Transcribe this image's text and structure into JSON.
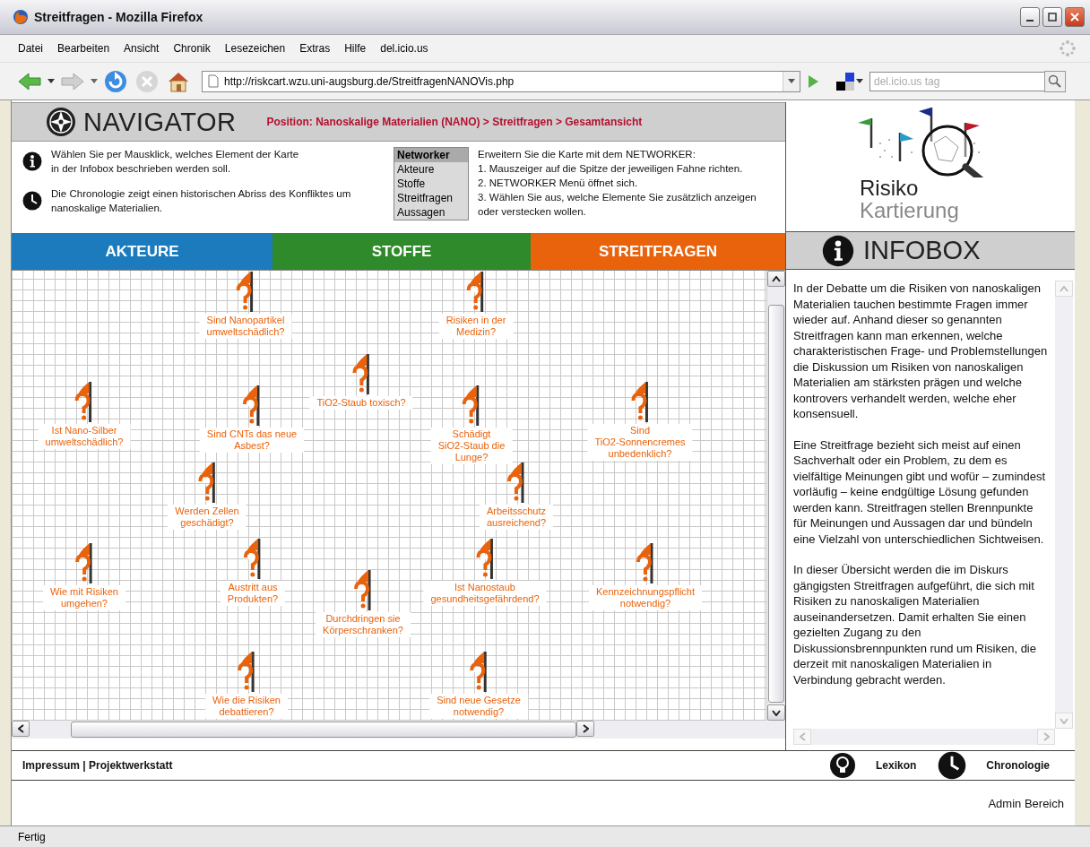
{
  "window": {
    "title": "Streitfragen - Mozilla Firefox"
  },
  "menu": [
    "Datei",
    "Bearbeiten",
    "Ansicht",
    "Chronik",
    "Lesezeichen",
    "Extras",
    "Hilfe",
    "del.icio.us"
  ],
  "toolbar": {
    "url": "http://riskcart.wzu.uni-augsburg.de/StreitfragenNANOVis.php",
    "tag_placeholder": "del.icio.us tag"
  },
  "navigator": {
    "title": "NAVIGATOR",
    "position": "Position: Nanoskalige Materialien (NANO) > Streitfragen > Gesamtansicht"
  },
  "hints": [
    {
      "kind": "info",
      "lines": [
        "Wählen Sie per Mausklick, welches Element der Karte",
        "in der Infobox beschrieben werden soll."
      ]
    },
    {
      "kind": "clock",
      "lines": [
        "Die Chronologie zeigt einen historischen Abriss des Konfliktes um",
        "nanoskalige Materialien."
      ]
    }
  ],
  "networker": {
    "title": "Networker",
    "items": [
      "Akteure",
      "Stoffe",
      "Streitfragen",
      "Aussagen"
    ]
  },
  "networker_help": [
    "Erweitern Sie die Karte mit dem NETWORKER:",
    "1. Mauszeiger auf die Spitze der jeweiligen Fahne richten.",
    "2. NETWORKER Menü öffnet sich.",
    "3. Wählen Sie aus, welche Elemente Sie zusätzlich anzeigen",
    "oder verstecken wollen."
  ],
  "categories": [
    {
      "label": "AKTEURE",
      "color": "#1b7bbd"
    },
    {
      "label": "STOFFE",
      "color": "#2e8a2a"
    },
    {
      "label": "STREITFRAGEN",
      "color": "#e9620c"
    }
  ],
  "logo": {
    "line_1": "Risiko",
    "line_2": "Kartierung"
  },
  "infobox": {
    "title": "INFOBOX",
    "paragraphs": [
      "In der Debatte um die Risiken von nanoskaligen Materialien tauchen bestimmte Fragen immer wieder auf. Anhand dieser so genannten Streitfragen kann man erkennen, welche charakteristischen Frage- und Problemstellungen die Diskussion um Risiken von nanoskaligen Materialien am stärksten prägen und welche kontrovers verhandelt werden, welche eher konsensuell.",
      "Eine Streitfrage bezieht sich meist auf einen Sachverhalt oder ein Problem, zu dem es vielfältige Meinungen gibt und wofür – zumindest vorläufig – keine endgültige Lösung gefunden werden kann. Streitfragen stellen Brennpunkte für Meinungen und Aussagen dar und bündeln eine Vielzahl von unterschiedlichen Sichtweisen.",
      "In dieser Übersicht werden die im Diskurs gängigsten Streitfragen aufgeführt, die sich mit Risiken zu nanoskaligen Materialien auseinandersetzen. Damit erhalten Sie einen gezielten Zugang zu den Diskussionsbrennpunkten rund um Risiken, die derzeit mit nanoskaligen Materialien in Verbindung gebracht werden."
    ]
  },
  "map": {
    "questions": [
      {
        "lines": [
          "Sind Nanopartikel",
          "umweltschädlich?"
        ]
      },
      {
        "lines": [
          "Risiken in der",
          "Medizin?"
        ]
      },
      {
        "lines": [
          "TiO2-Staub toxisch?"
        ]
      },
      {
        "lines": [
          "Ist Nano-Silber",
          "umweltschädlich?"
        ]
      },
      {
        "lines": [
          "Sind CNTs das neue",
          "Asbest?"
        ]
      },
      {
        "lines": [
          "Schädigt",
          "SiO2-Staub die",
          "Lunge?"
        ]
      },
      {
        "lines": [
          "Sind",
          "TiO2-Sonnencremes",
          "unbedenklich?"
        ]
      },
      {
        "lines": [
          "Werden Zellen",
          "geschädigt?"
        ]
      },
      {
        "lines": [
          "Arbeitsschutz",
          "ausreichend?"
        ]
      },
      {
        "lines": [
          "Wie mit Risiken",
          "umgehen?"
        ]
      },
      {
        "lines": [
          "Austritt aus",
          "Produkten?"
        ]
      },
      {
        "lines": [
          "Ist Nanostaub",
          "gesundheitsgefährdend?"
        ]
      },
      {
        "lines": [
          "Kennzeichnungspflicht",
          "notwendig?"
        ]
      },
      {
        "lines": [
          "Durchdringen sie",
          "Körperschranken?"
        ]
      },
      {
        "lines": [
          "Wie die Risiken",
          "debattieren?"
        ]
      },
      {
        "lines": [
          "Sind neue Gesetze",
          "notwendig?"
        ]
      }
    ]
  },
  "footer": {
    "links": "Impressum | Projektwerkstatt",
    "tools": [
      {
        "kind": "bulb",
        "label": "Lexikon"
      },
      {
        "kind": "clock",
        "label": "Chronologie"
      }
    ],
    "admin": "Admin Bereich"
  },
  "status_bar": "Fertig"
}
